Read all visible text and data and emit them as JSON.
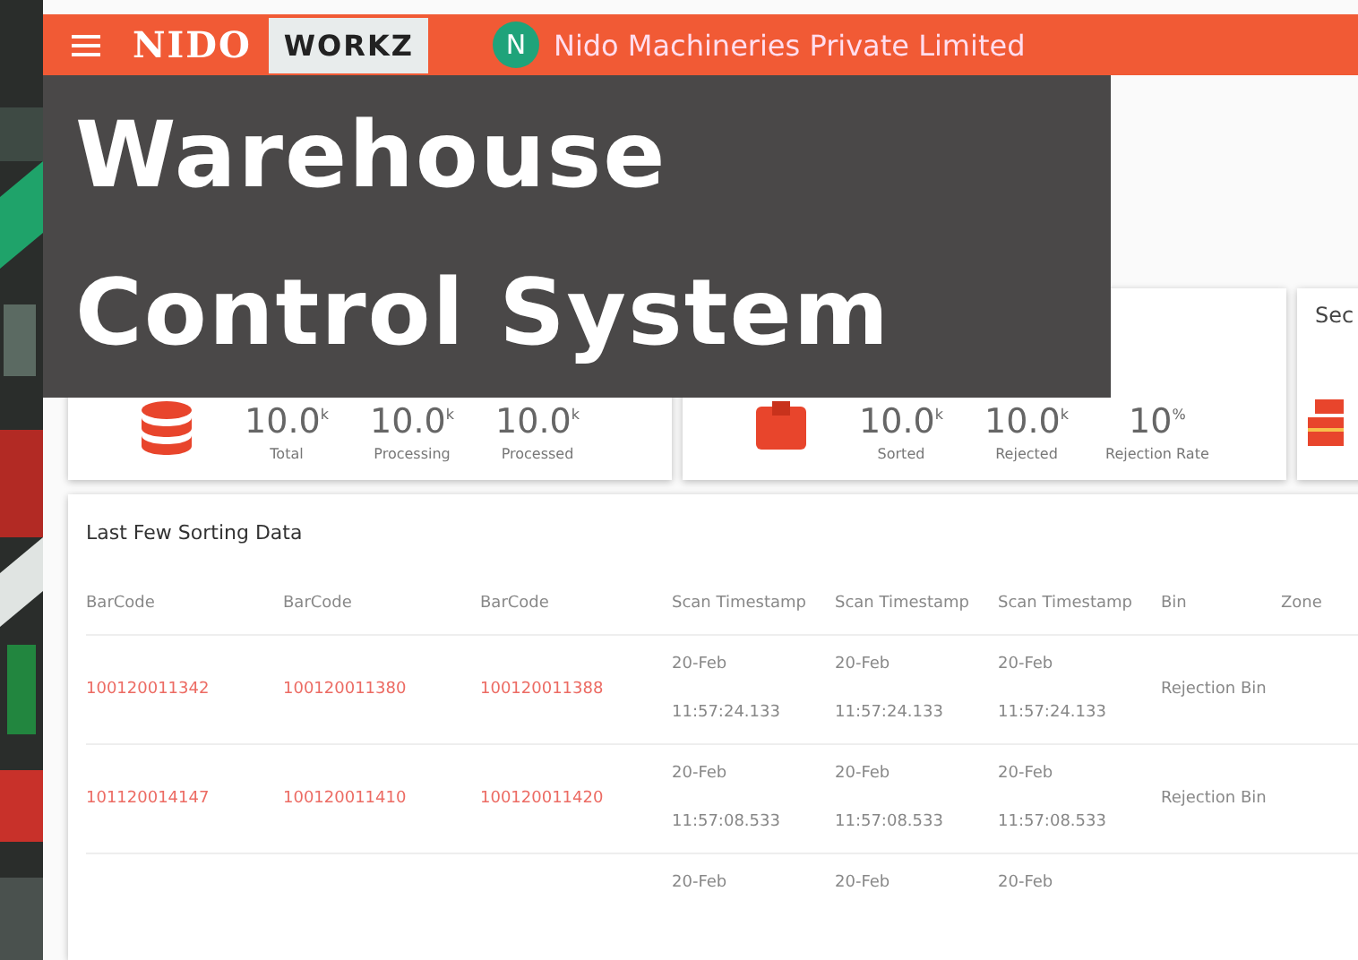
{
  "header": {
    "brand": "NIDO",
    "product": "WORKZ",
    "avatar_letter": "N",
    "company": "Nido Machineries Private Limited"
  },
  "overlay_title": [
    "Warehouse",
    "Control System"
  ],
  "cards": [
    {
      "stats": [
        {
          "value": "10.0$^{k}$",
          "label": "Total"
        },
        {
          "value": "10.0$^{k}$",
          "label": "Processing"
        },
        {
          "value": "10.0$^{k}$",
          "label": "Processed"
        }
      ]
    },
    {
      "stats": [
        {
          "value": "10.0$^{k}$",
          "label": "Sorted"
        },
        {
          "value": "10.0$^{k}$",
          "label": "Rejected"
        },
        {
          "value": "10$^{%}$",
          "label": "Rejection Rate"
        }
      ]
    },
    {
      "title": "Sec"
    }
  ],
  "table": {
    "title": "Last Few Sorting Data",
    "columns": [
      "BarCode",
      "BarCode",
      "BarCode",
      "Scan Timestamp",
      "Scan Timestamp",
      "Scan Timestamp",
      "Bin",
      "Zone"
    ],
    "rows": [
      {
        "barcodes": [
          "100120011342",
          "100120011380",
          "100120011388"
        ],
        "timestamps": [
          "20-Feb 11:57:24.133",
          "20-Feb 11:57:24.133",
          "20-Feb 11:57:24.133"
        ],
        "bin": "Rejection Bin"
      },
      {
        "barcodes": [
          "101120014147",
          "100120011410",
          "100120011420"
        ],
        "timestamps": [
          "20-Feb 11:57:08.533",
          "20-Feb 11:57:08.533",
          "20-Feb 11:57:08.533"
        ],
        "bin": "Rejection Bin"
      },
      {
        "timestamps": [
          "20-Feb",
          "20-Feb",
          "20-Feb"
        ]
      }
    ]
  }
}
